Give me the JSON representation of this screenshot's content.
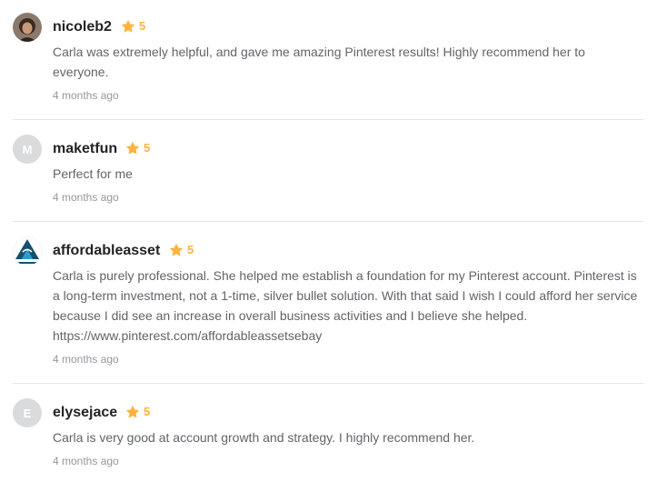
{
  "colors": {
    "star": "#ffb33e",
    "username": "#222325",
    "text": "#62646a",
    "time": "#95979d",
    "divider": "#e4e5e7"
  },
  "reviews": [
    {
      "username": "nicoleb2",
      "avatar_letter": "",
      "rating": "5",
      "text": "Carla was extremely helpful, and gave me amazing Pinterest results! Highly recommend her to everyone.",
      "time": "4 months ago"
    },
    {
      "username": "maketfun",
      "avatar_letter": "M",
      "rating": "5",
      "text": "Perfect for me",
      "time": "4 months ago"
    },
    {
      "username": "affordableasset",
      "avatar_letter": "",
      "rating": "5",
      "text": "Carla is purely professional. She helped me establish a foundation for my Pinterest account. Pinterest is a long-term investment, not a 1-time, silver bullet solution. With that said I wish I could afford her service because I did see an increase in overall business activities and I believe she helped. https://www.pinterest.com/affordableassetsebay",
      "time": "4 months ago"
    },
    {
      "username": "elysejace",
      "avatar_letter": "E",
      "rating": "5",
      "text": "Carla is very good at account growth and strategy. I highly recommend her.",
      "time": "4 months ago"
    }
  ]
}
